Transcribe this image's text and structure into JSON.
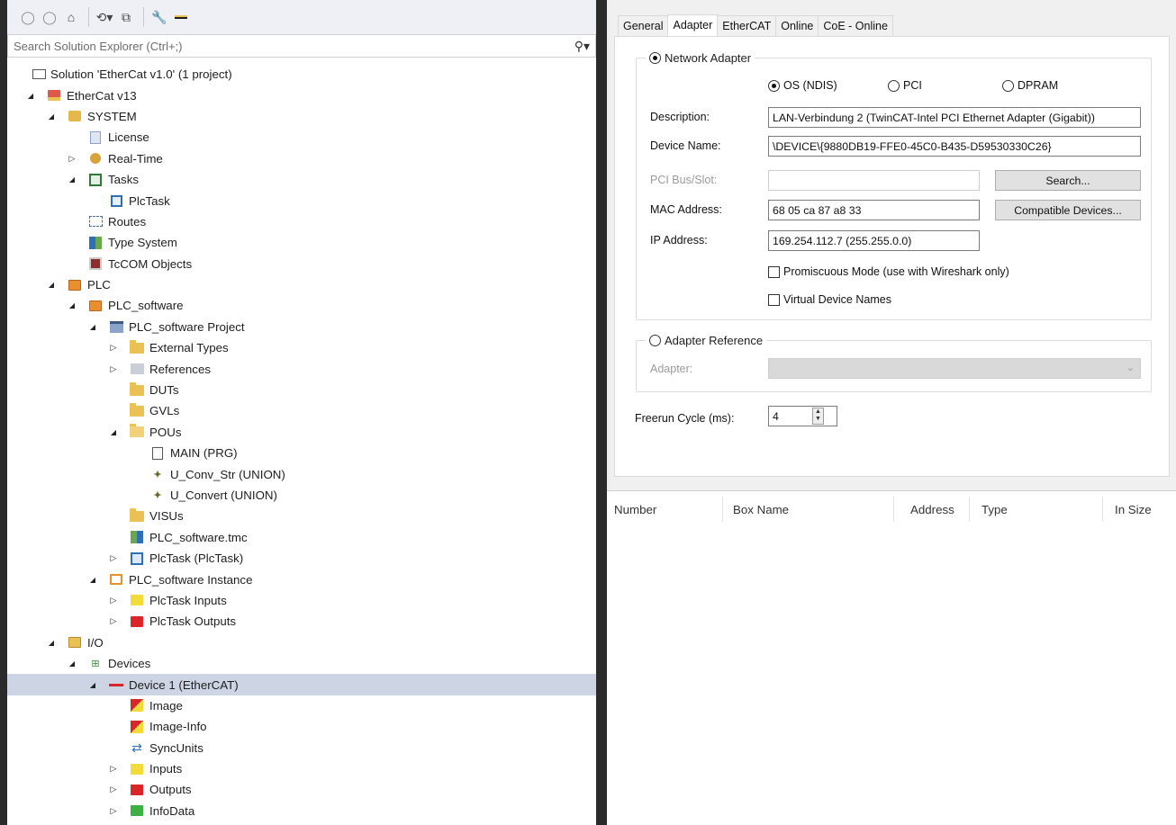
{
  "solution_explorer": {
    "search_placeholder": "Search Solution Explorer (Ctrl+;)",
    "tree": [
      {
        "label": "Solution 'EtherCat v1.0' (1 project)",
        "icon": "solution-icon"
      },
      {
        "label": "EtherCat v13",
        "icon": "project-icon"
      },
      {
        "label": "SYSTEM",
        "icon": "system-icon"
      },
      {
        "label": "License",
        "icon": "license-icon"
      },
      {
        "label": "Real-Time",
        "icon": "realtime-icon"
      },
      {
        "label": "Tasks",
        "icon": "tasks-icon"
      },
      {
        "label": "PlcTask",
        "icon": "task-icon"
      },
      {
        "label": "Routes",
        "icon": "routes-icon"
      },
      {
        "label": "Type System",
        "icon": "type-system-icon"
      },
      {
        "label": "TcCOM Objects",
        "icon": "tccom-icon"
      },
      {
        "label": "PLC",
        "icon": "plc-icon"
      },
      {
        "label": "PLC_software",
        "icon": "plc-icon"
      },
      {
        "label": "PLC_software Project",
        "icon": "plc-project-icon"
      },
      {
        "label": "External Types",
        "icon": "folder-icon"
      },
      {
        "label": "References",
        "icon": "references-icon"
      },
      {
        "label": "DUTs",
        "icon": "folder-icon"
      },
      {
        "label": "GVLs",
        "icon": "folder-icon"
      },
      {
        "label": "POUs",
        "icon": "folder-open-icon"
      },
      {
        "label": "MAIN (PRG)",
        "icon": "program-icon"
      },
      {
        "label": "U_Conv_Str (UNION)",
        "icon": "union-icon"
      },
      {
        "label": "U_Convert (UNION)",
        "icon": "union-icon"
      },
      {
        "label": "VISUs",
        "icon": "folder-icon"
      },
      {
        "label": "PLC_software.tmc",
        "icon": "tmc-icon"
      },
      {
        "label": "PlcTask (PlcTask)",
        "icon": "plctask-icon"
      },
      {
        "label": "PLC_software Instance",
        "icon": "instance-icon"
      },
      {
        "label": "PlcTask Inputs",
        "icon": "inputs-icon"
      },
      {
        "label": "PlcTask Outputs",
        "icon": "outputs-icon"
      },
      {
        "label": "I/O",
        "icon": "io-icon"
      },
      {
        "label": "Devices",
        "icon": "devices-icon"
      },
      {
        "label": "Device 1 (EtherCAT)",
        "icon": "ethercat-device-icon"
      },
      {
        "label": "Image",
        "icon": "image-icon"
      },
      {
        "label": "Image-Info",
        "icon": "image-icon"
      },
      {
        "label": "SyncUnits",
        "icon": "sync-icon"
      },
      {
        "label": "Inputs",
        "icon": "inputs-icon"
      },
      {
        "label": "Outputs",
        "icon": "outputs-icon"
      },
      {
        "label": "InfoData",
        "icon": "infodata-icon"
      }
    ]
  },
  "tabs": [
    "General",
    "Adapter",
    "EtherCAT",
    "Online",
    "CoE - Online"
  ],
  "active_tab": "Adapter",
  "adapter": {
    "network_adapter_label": "Network Adapter",
    "options": [
      "OS (NDIS)",
      "PCI",
      "DPRAM"
    ],
    "selected_option": "OS (NDIS)",
    "description_label": "Description:",
    "description_value": "LAN-Verbindung 2 (TwinCAT-Intel PCI Ethernet Adapter (Gigabit))",
    "device_name_label": "Device Name:",
    "device_name_value": "\\DEVICE\\{9880DB19-FFE0-45C0-B435-D59530330C26}",
    "pci_label": "PCI Bus/Slot:",
    "pci_value": "",
    "search_button": "Search...",
    "mac_label": "MAC Address:",
    "mac_value": "68 05 ca 87 a8 33",
    "compatible_button": "Compatible Devices...",
    "ip_label": "IP Address:",
    "ip_value": "169.254.112.7 (255.255.0.0)",
    "promiscuous_label": "Promiscuous Mode (use with Wireshark only)",
    "promiscuous_checked": false,
    "virtual_names_label": "Virtual Device Names",
    "virtual_names_checked": false,
    "adapter_reference_label": "Adapter Reference",
    "adapter_label": "Adapter:",
    "adapter_value": "",
    "freerun_label": "Freerun Cycle (ms):",
    "freerun_value": "4"
  },
  "grid": {
    "columns": [
      "Number",
      "Box Name",
      "Address",
      "Type",
      "In Size"
    ]
  }
}
